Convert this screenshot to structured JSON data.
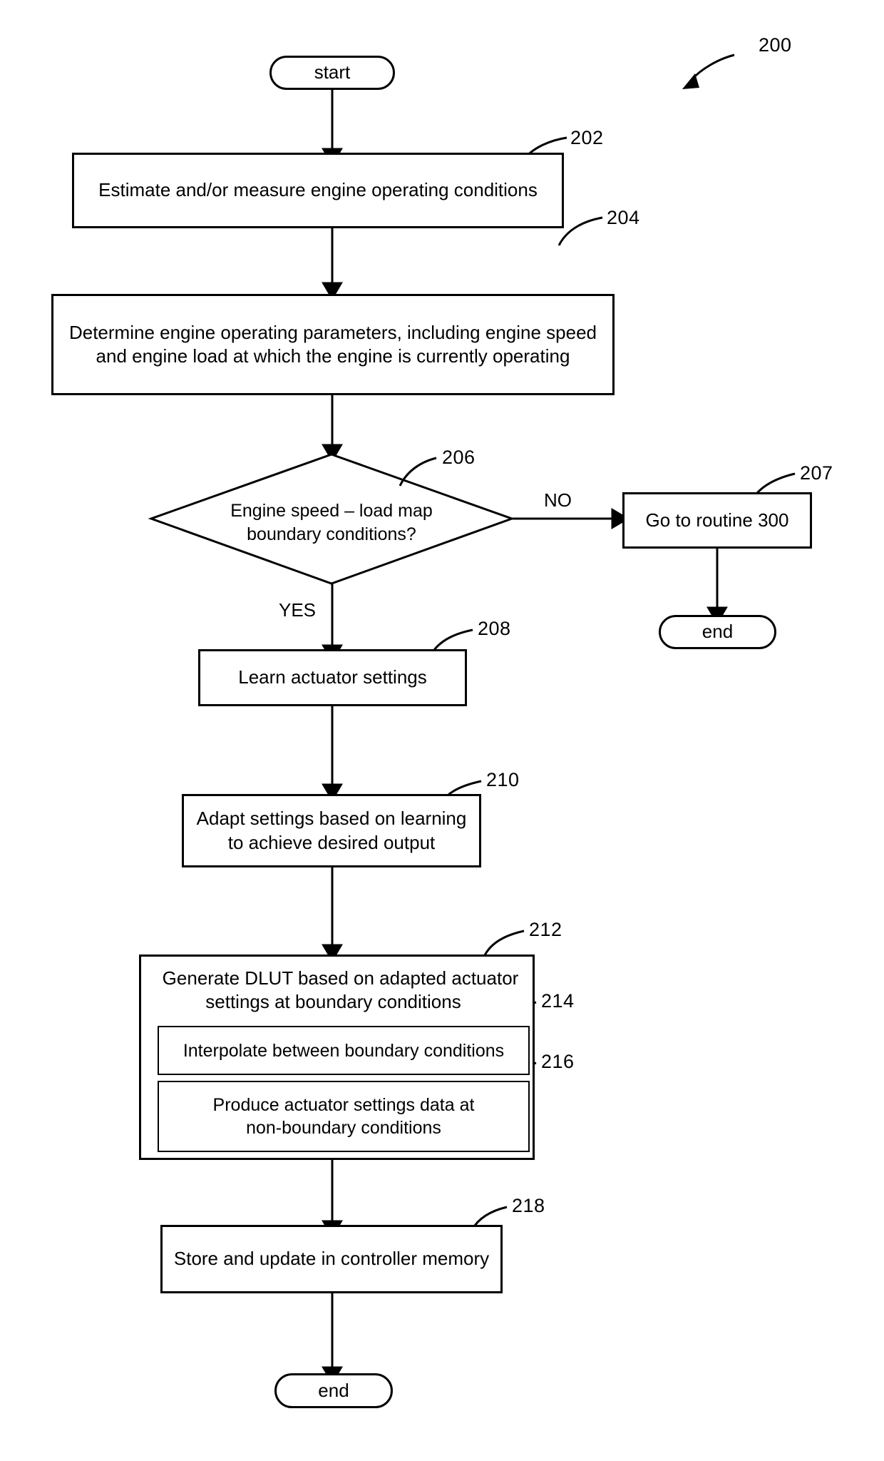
{
  "figure": {
    "number": "200",
    "type": "flowchart"
  },
  "nodes": {
    "start": {
      "label": "start",
      "ref": ""
    },
    "n202": {
      "label": "Estimate and/or measure engine operating conditions",
      "ref": "202"
    },
    "n204": {
      "label": "Determine engine operating parameters, including engine speed\nand engine load at which the engine is currently operating",
      "ref": "204"
    },
    "n206": {
      "label": "Engine speed – load map\nboundary conditions?",
      "ref": "206"
    },
    "n207": {
      "label": "Go to routine 300",
      "ref": "207"
    },
    "end_no": {
      "label": "end",
      "ref": ""
    },
    "n208": {
      "label": "Learn actuator settings",
      "ref": "208"
    },
    "n210": {
      "label": "Adapt settings based on learning\nto achieve desired output",
      "ref": "210"
    },
    "n212": {
      "label": "Generate DLUT based on adapted actuator\nsettings at boundary conditions",
      "ref": "212"
    },
    "n214": {
      "label": "Interpolate between boundary conditions",
      "ref": "214"
    },
    "n216": {
      "label": "Produce actuator settings data at\nnon-boundary conditions",
      "ref": "216"
    },
    "n218": {
      "label": "Store and update in controller memory",
      "ref": "218"
    },
    "end_yes": {
      "label": "end",
      "ref": ""
    }
  },
  "branches": {
    "no": "NO",
    "yes": "YES"
  },
  "colors": {
    "stroke": "#000000",
    "fill": "#ffffff",
    "text": "#000000"
  }
}
